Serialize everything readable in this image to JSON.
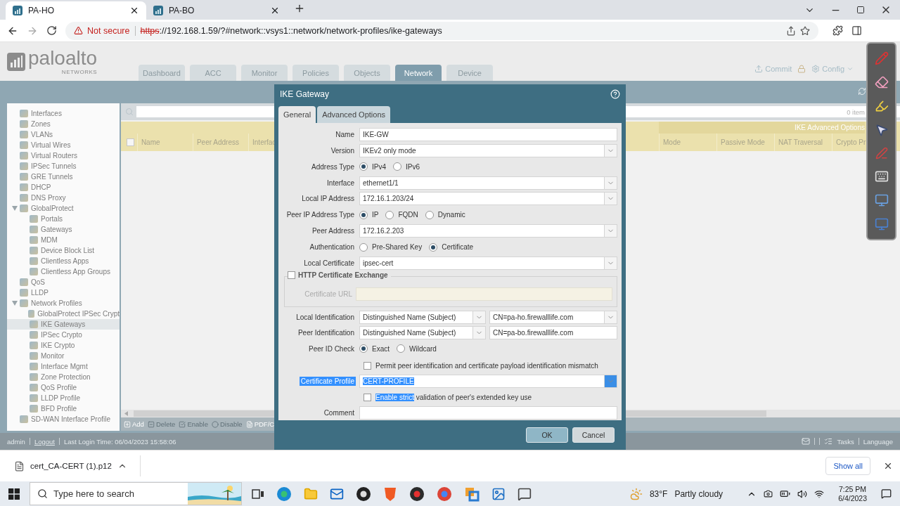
{
  "browser": {
    "tabs": [
      {
        "title": "PA-HO",
        "selected": true
      },
      {
        "title": "PA-BO",
        "selected": false
      }
    ],
    "security": "Not secure",
    "url_scheme": "https",
    "url_rest": "://192.168.1.59/?#network::vsys1::network/network-profiles/ike-gateways"
  },
  "app": {
    "logo": "paloalto",
    "logo_tagline": "NETWORKS",
    "tabs": [
      {
        "label": "Dashboard",
        "selected": false
      },
      {
        "label": "ACC",
        "selected": false
      },
      {
        "label": "Monitor",
        "selected": false
      },
      {
        "label": "Policies",
        "selected": false
      },
      {
        "label": "Objects",
        "selected": false
      },
      {
        "label": "Network",
        "selected": true
      },
      {
        "label": "Device",
        "selected": false
      }
    ],
    "actions": [
      {
        "label": "Commit",
        "kind": "commit"
      },
      {
        "label": "Config",
        "kind": "config"
      }
    ]
  },
  "sidebar": [
    {
      "label": "Interfaces",
      "selected": false
    },
    {
      "label": "Zones",
      "selected": false
    },
    {
      "label": "VLANs",
      "selected": false
    },
    {
      "label": "Virtual Wires",
      "selected": false
    },
    {
      "label": "Virtual Routers",
      "selected": false
    },
    {
      "label": "IPSec Tunnels",
      "selected": false
    },
    {
      "label": "GRE Tunnels",
      "selected": false
    },
    {
      "label": "DHCP",
      "selected": false
    },
    {
      "label": "DNS Proxy",
      "selected": false
    },
    {
      "label": "GlobalProtect",
      "selected": false,
      "expanded": true,
      "children": [
        {
          "label": "Portals",
          "selected": false
        },
        {
          "label": "Gateways",
          "selected": false
        },
        {
          "label": "MDM",
          "selected": false
        },
        {
          "label": "Device Block List",
          "selected": false
        },
        {
          "label": "Clientless Apps",
          "selected": false
        },
        {
          "label": "Clientless App Groups",
          "selected": false
        }
      ]
    },
    {
      "label": "QoS",
      "selected": false
    },
    {
      "label": "LLDP",
      "selected": false
    },
    {
      "label": "Network Profiles",
      "selected": false,
      "expanded": true,
      "children": [
        {
          "label": "GlobalProtect IPSec Crypt",
          "selected": false
        },
        {
          "label": "IKE Gateways",
          "selected": true
        },
        {
          "label": "IPSec Crypto",
          "selected": false
        },
        {
          "label": "IKE Crypto",
          "selected": false
        },
        {
          "label": "Monitor",
          "selected": false
        },
        {
          "label": "Interface Mgmt",
          "selected": false
        },
        {
          "label": "Zone Protection",
          "selected": false
        },
        {
          "label": "QoS Profile",
          "selected": false
        },
        {
          "label": "LLDP Profile",
          "selected": false
        },
        {
          "label": "BFD Profile",
          "selected": false
        }
      ]
    },
    {
      "label": "SD-WAN Interface Profile",
      "selected": false
    }
  ],
  "table": {
    "select_all_checked": false,
    "item_count": "0 item",
    "group_header": "IKE Advanced Options",
    "columns_left": [
      "Name",
      "Peer Address",
      "Interfac"
    ],
    "columns_right": [
      "Mode",
      "Passive Mode",
      "NAT Traversal",
      "Crypto Pr"
    ]
  },
  "toolbar": [
    {
      "label": "Add",
      "kind": "add",
      "disabled": false
    },
    {
      "label": "Delete",
      "kind": "delete",
      "disabled": true
    },
    {
      "label": "Enable",
      "kind": "enable",
      "disabled": true
    },
    {
      "label": "Disable",
      "kind": "disable",
      "disabled": true
    },
    {
      "label": "PDF/C",
      "kind": "pdf",
      "disabled": false
    }
  ],
  "status_bar": {
    "user": "admin",
    "logout": "Logout",
    "last_login": "Last Login Time: 06/04/2023 15:58:06",
    "tasks": "Tasks",
    "language": "Language"
  },
  "dialog": {
    "title": "IKE Gateway",
    "tabs": [
      {
        "label": "General",
        "selected": true
      },
      {
        "label": "Advanced Options",
        "selected": false
      }
    ],
    "rows": [
      {
        "kind": "text",
        "label": "Name",
        "value": "IKE-GW"
      },
      {
        "kind": "select",
        "label": "Version",
        "value": "IKEv2 only mode",
        "highlighted": false
      },
      {
        "kind": "radio",
        "label": "Address Type",
        "options": [
          {
            "label": "IPv4",
            "selected": true
          },
          {
            "label": "IPv6",
            "selected": false
          }
        ]
      },
      {
        "kind": "select",
        "label": "Interface",
        "value": "ethernet1/1",
        "highlighted": false
      },
      {
        "kind": "select",
        "label": "Local IP Address",
        "value": "172.16.1.203/24",
        "highlighted": false
      },
      {
        "kind": "radio",
        "label": "Peer IP Address Type",
        "options": [
          {
            "label": "IP",
            "selected": true
          },
          {
            "label": "FQDN",
            "selected": false
          },
          {
            "label": "Dynamic",
            "selected": false
          }
        ]
      },
      {
        "kind": "select",
        "label": "Peer Address",
        "value": "172.16.2.203",
        "highlighted": false
      },
      {
        "kind": "radio",
        "label": "Authentication",
        "options": [
          {
            "label": "Pre-Shared Key",
            "selected": false
          },
          {
            "label": "Certificate",
            "selected": true
          }
        ]
      },
      {
        "kind": "select",
        "label": "Local Certificate",
        "value": "ipsec-cert",
        "highlighted": false
      },
      {
        "kind": "fieldset",
        "legend": "HTTP Certificate Exchange",
        "checked": false,
        "field_label": "Certificate URL",
        "disabled": true
      },
      {
        "kind": "pair",
        "label": "Local Identification",
        "type": "Distinguished Name (Subject)",
        "id": {
          "kind": "select",
          "value": "CN=pa-ho.firewalllife.com"
        }
      },
      {
        "kind": "pair",
        "label": "Peer Identification",
        "type": "Distinguished Name (Subject)",
        "id": {
          "kind": "text",
          "value": "CN=pa-bo.firewalllife.com"
        }
      },
      {
        "kind": "radio",
        "label": "Peer ID Check",
        "options": [
          {
            "label": "Exact",
            "selected": true
          },
          {
            "label": "Wildcard",
            "selected": false
          }
        ]
      },
      {
        "kind": "checkbox",
        "checked": false,
        "parts": [
          {
            "text": "Permit peer identification and certificate payload identification mismatch",
            "highlighted": false
          }
        ]
      },
      {
        "kind": "select",
        "label": "Certificate Profile",
        "value": "CERT-PROFILE",
        "highlighted": true
      },
      {
        "kind": "checkbox",
        "checked": false,
        "parts": [
          {
            "text": "Enable strict",
            "highlighted": true
          },
          {
            "text": " validation of peer's extended key use",
            "highlighted": false
          }
        ]
      },
      {
        "kind": "text",
        "label": "Comment"
      }
    ],
    "buttons": [
      {
        "label": "OK",
        "kind": "primary"
      },
      {
        "label": "Cancel",
        "kind": "secondary"
      }
    ]
  },
  "downloads": {
    "file": "cert_CA-CERT (1).p12",
    "show_all": "Show all"
  },
  "taskbar": {
    "search_placeholder": "Type here to search",
    "temperature": "83°F",
    "weather": "Partly cloudy",
    "time": "7:25 PM",
    "date": "6/4/2023"
  }
}
